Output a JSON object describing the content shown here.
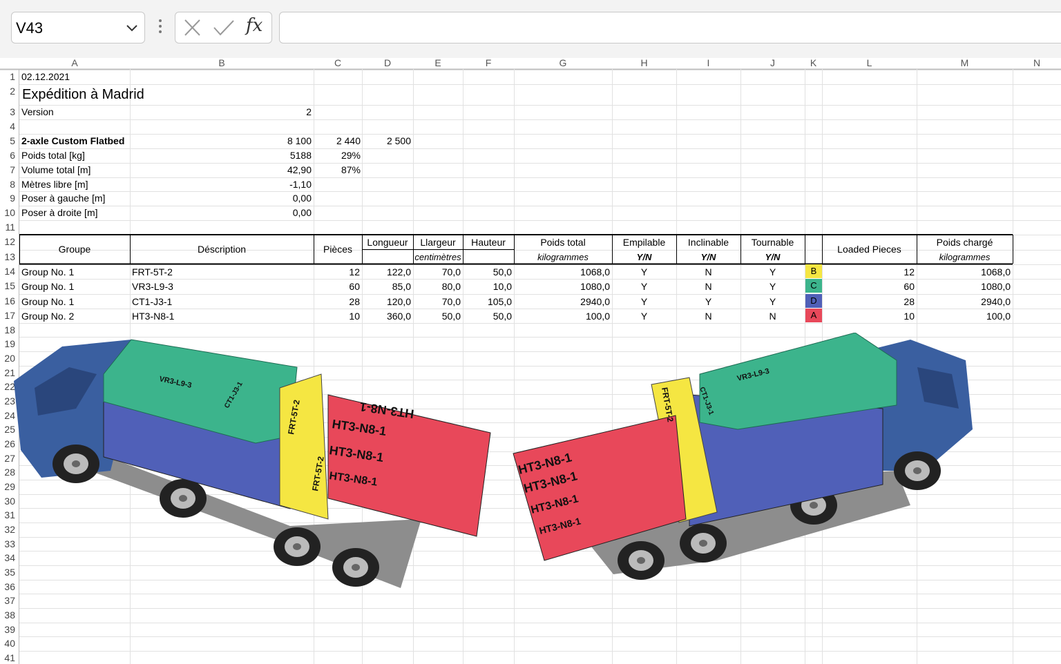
{
  "namebox": {
    "value": "V43"
  },
  "formula_bar": {
    "fx_label": "fx",
    "content": ""
  },
  "columns": [
    "A",
    "B",
    "C",
    "D",
    "E",
    "F",
    "G",
    "H",
    "I",
    "J",
    "K",
    "L",
    "M",
    "N"
  ],
  "rows": [
    "1",
    "2",
    "3",
    "4",
    "5",
    "6",
    "7",
    "8",
    "9",
    "10",
    "11",
    "12",
    "13",
    "14",
    "15",
    "16",
    "17",
    "18",
    "19",
    "20",
    "21",
    "22",
    "23",
    "24",
    "25",
    "26",
    "27",
    "28",
    "29",
    "30",
    "31",
    "32",
    "33",
    "34",
    "35",
    "36",
    "37",
    "38",
    "39",
    "40",
    "41"
  ],
  "top": {
    "date": "02.12.2021",
    "title": "Expédition à Madrid",
    "version_label": "Version",
    "version_value": "2",
    "truck_label": "2-axle Custom Flatbed",
    "truck_len": "8 100",
    "truck_wid": "2 440",
    "truck_hei": "2 500",
    "weight_label": "Poids total [kg]",
    "weight_value": "5188",
    "weight_pct": "29%",
    "volume_label": "Volume total [m]",
    "volume_value": "42,90",
    "volume_pct": "87%",
    "free_label": "Mètres libre [m]",
    "free_value": "-1,10",
    "left_label": "Poser à gauche [m]",
    "left_value": "0,00",
    "right_label": "Poser à droite [m]",
    "right_value": "0,00"
  },
  "table_headers": {
    "groupe": "Groupe",
    "description": "Déscription",
    "pieces": "Pièces",
    "longueur": "Longueur",
    "largeur": "Llargeur",
    "hauteur": "Hauteur",
    "dims_unit": "centimètres",
    "poids": "Poids total",
    "poids_unit": "kilogrammes",
    "empilable": "Empilable",
    "inclinable": "Inclinable",
    "tournable": "Tournable",
    "yn": "Y/N",
    "loaded": "Loaded Pieces",
    "poids_charge": "Poids chargé",
    "poids_charge_unit": "kilogrammes"
  },
  "table_rows": [
    {
      "groupe": "Group No. 1",
      "desc": "FRT-5T-2",
      "pieces": "12",
      "long": "122,0",
      "larg": "70,0",
      "haut": "50,0",
      "poids": "1068,0",
      "emp": "Y",
      "inc": "N",
      "tour": "Y",
      "tag": "B",
      "tag_color": "#f5e642",
      "loaded": "12",
      "charge": "1068,0"
    },
    {
      "groupe": "Group No. 1",
      "desc": "VR3-L9-3",
      "pieces": "60",
      "long": "85,0",
      "larg": "80,0",
      "haut": "10,0",
      "poids": "1080,0",
      "emp": "Y",
      "inc": "N",
      "tour": "Y",
      "tag": "C",
      "tag_color": "#3cb48c",
      "loaded": "60",
      "charge": "1080,0"
    },
    {
      "groupe": "Group No. 1",
      "desc": "CT1-J3-1",
      "pieces": "28",
      "long": "120,0",
      "larg": "70,0",
      "haut": "105,0",
      "poids": "2940,0",
      "emp": "Y",
      "inc": "Y",
      "tour": "Y",
      "tag": "D",
      "tag_color": "#5060b8",
      "loaded": "28",
      "charge": "2940,0"
    },
    {
      "groupe": "Group No. 2",
      "desc": "HT3-N8-1",
      "pieces": "10",
      "long": "360,0",
      "larg": "50,0",
      "haut": "50,0",
      "poids": "100,0",
      "emp": "Y",
      "inc": "N",
      "tour": "N",
      "tag": "A",
      "tag_color": "#e8485a",
      "loaded": "10",
      "charge": "100,0"
    }
  ],
  "image_labels": {
    "red": "HT3-N8-1",
    "yellow": "FRT-5T-2",
    "green": "VR3-L9-3",
    "blue": "CT1-J3-1"
  },
  "colors": {
    "cargo_red": "#e8485a",
    "cargo_yellow": "#f5e642",
    "cargo_green": "#3cb48c",
    "cargo_blue": "#5060b8",
    "truck_cab": "#3a5fa0"
  }
}
